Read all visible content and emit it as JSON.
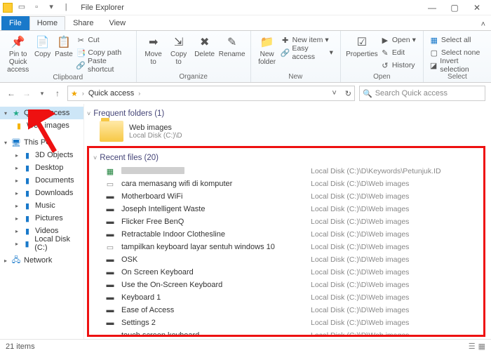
{
  "window": {
    "title": "File Explorer"
  },
  "tabs": {
    "file": "File",
    "home": "Home",
    "share": "Share",
    "view": "View"
  },
  "ribbon": {
    "clipboard": {
      "pin": "Pin to Quick\naccess",
      "copy": "Copy",
      "paste": "Paste",
      "cut": "Cut",
      "copypath": "Copy path",
      "pasteshortcut": "Paste shortcut",
      "label": "Clipboard"
    },
    "organize": {
      "move": "Move\nto",
      "copyto": "Copy\nto",
      "delete": "Delete",
      "rename": "Rename",
      "label": "Organize"
    },
    "new": {
      "newfolder": "New\nfolder",
      "newitem": "New item",
      "easyaccess": "Easy access",
      "label": "New"
    },
    "open": {
      "properties": "Properties",
      "open": "Open",
      "edit": "Edit",
      "history": "History",
      "label": "Open"
    },
    "select": {
      "all": "Select all",
      "none": "Select none",
      "invert": "Invert selection",
      "label": "Select"
    }
  },
  "addressbar": {
    "crumb1": "Quick access",
    "search_placeholder": "Search Quick access"
  },
  "sidebar": {
    "quick": "Quick access",
    "webimages": "Web images",
    "thispc": "This PC",
    "items": [
      "3D Objects",
      "Desktop",
      "Documents",
      "Downloads",
      "Music",
      "Pictures",
      "Videos",
      "Local Disk (C:)"
    ],
    "network": "Network"
  },
  "frequent": {
    "header": "Frequent folders (1)",
    "item": {
      "name": "Web images",
      "sub": "Local Disk (C:)\\D"
    }
  },
  "recent": {
    "header": "Recent files (20)",
    "path_common": "Local Disk (C:)\\D\\Web images",
    "path_alt": "Local Disk (C:)\\D\\Keywords\\Petunjuk.ID",
    "rows": [
      {
        "name": "",
        "blurred": true,
        "alt_path": true,
        "ic": "xls"
      },
      {
        "name": "cara memasang wifi di komputer",
        "ic": "doc"
      },
      {
        "name": "Motherboard WiFi",
        "ic": "img"
      },
      {
        "name": "Joseph Intelligent Waste",
        "ic": "img"
      },
      {
        "name": "Flicker Free BenQ",
        "ic": "img"
      },
      {
        "name": "Retractable Indoor Clothesline",
        "ic": "img"
      },
      {
        "name": "tampilkan keyboard layar sentuh windows 10",
        "ic": "doc"
      },
      {
        "name": "OSK",
        "ic": "img"
      },
      {
        "name": "On Screen Keyboard",
        "ic": "img"
      },
      {
        "name": "Use the On-Screen Keyboard",
        "ic": "img"
      },
      {
        "name": "Keyboard 1",
        "ic": "img"
      },
      {
        "name": "Ease of Access",
        "ic": "img"
      },
      {
        "name": "Settings 2",
        "ic": "img"
      },
      {
        "name": "touch screen keyboard",
        "ic": "img"
      }
    ]
  },
  "status": {
    "count": "21 items"
  }
}
